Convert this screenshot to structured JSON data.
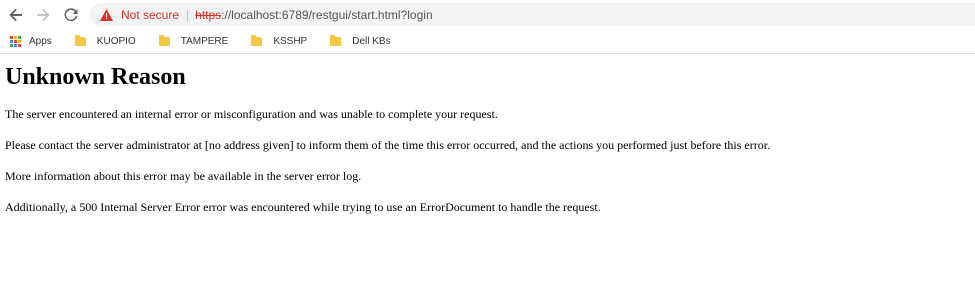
{
  "browser": {
    "security_label": "Not secure",
    "url_scheme": "https",
    "url_rest": "://localhost:6789/restgui/start.html?login",
    "bookmarks": [
      {
        "label": "Apps"
      },
      {
        "label": "KUOPIO"
      },
      {
        "label": "TAMPERE"
      },
      {
        "label": "KSSHP"
      },
      {
        "label": "Dell KBs"
      }
    ],
    "icons": {
      "back": "arrow-left",
      "forward": "arrow-right",
      "reload": "reload",
      "warning": "warning-triangle",
      "apps": "apps-grid",
      "folder": "folder"
    },
    "colors": {
      "warning": "#d93025",
      "folder": "#f5c842",
      "omnibox": "#f1f3f4"
    }
  },
  "page": {
    "title": "Unknown Reason",
    "paragraphs": [
      "The server encountered an internal error or misconfiguration and was unable to complete your request.",
      "Please contact the server administrator at [no address given] to inform them of the time this error occurred, and the actions you performed just before this error.",
      "More information about this error may be available in the server error log.",
      "Additionally, a 500 Internal Server Error error was encountered while trying to use an ErrorDocument to handle the request."
    ]
  }
}
